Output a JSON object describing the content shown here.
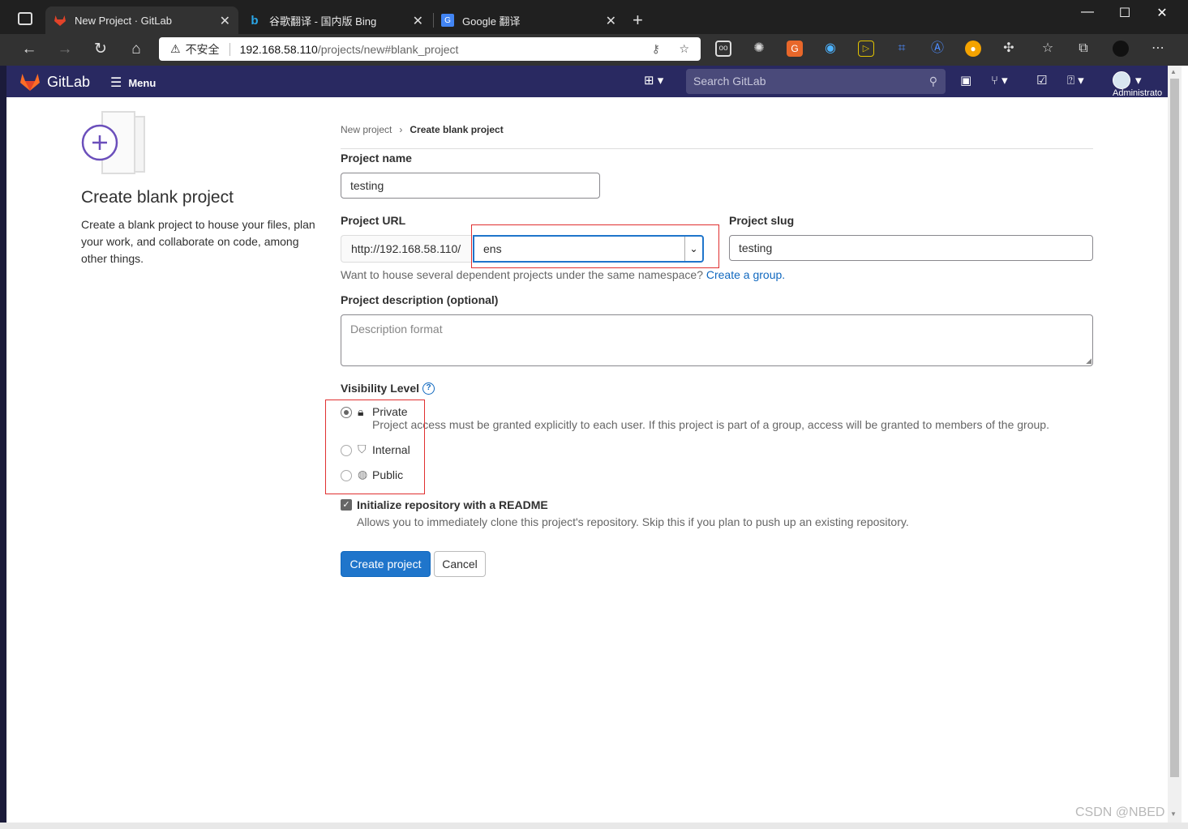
{
  "browser": {
    "tabs": [
      {
        "title": "New Project · GitLab",
        "active": true
      },
      {
        "title": "谷歌翻译 - 国内版 Bing",
        "active": false
      },
      {
        "title": "Google 翻译",
        "active": false
      }
    ],
    "security_label": "不安全",
    "url_host": "192.168.58.110",
    "url_path": "/projects/new#blank_project",
    "extensions": [
      "reader-icon",
      "settings-spider-icon",
      "translate-icon",
      "sync-icon",
      "terminal-icon",
      "crop-icon",
      "a-icon",
      "shield-icon",
      "puzzle-icon",
      "favorites-icon",
      "collections-icon",
      "profile-avatar",
      "more-icon"
    ]
  },
  "gitlab_header": {
    "brand": "GitLab",
    "menu_label": "Menu",
    "search_placeholder": "Search GitLab",
    "user_label": "Administrato"
  },
  "sidebar": {
    "title": "Create blank project",
    "description": "Create a blank project to house your files, plan your work, and collaborate on code, among other things."
  },
  "breadcrumb": {
    "parent": "New project",
    "separator": "›",
    "current": "Create blank project"
  },
  "form": {
    "project_name_label": "Project name",
    "project_name_value": "testing",
    "project_url_label": "Project URL",
    "url_prefix": "http://192.168.58.110/",
    "namespace_value": "ens",
    "project_slug_label": "Project slug",
    "project_slug_value": "testing",
    "namespace_help": "Want to house several dependent projects under the same namespace?",
    "create_group_link": "Create a group.",
    "description_label": "Project description (optional)",
    "description_placeholder": "Description format",
    "visibility_label": "Visibility Level",
    "visibility_options": [
      {
        "label": "Private",
        "icon": "lock-icon",
        "checked": true,
        "help": "Project access must be granted explicitly to each user. If this project is part of a group, access will be granted to members of the group."
      },
      {
        "label": "Internal",
        "icon": "shield-icon",
        "checked": false
      },
      {
        "label": "Public",
        "icon": "globe-icon",
        "checked": false
      }
    ],
    "readme_label": "Initialize repository with a README",
    "readme_checked": true,
    "readme_help": "Allows you to immediately clone this project's repository. Skip this if you plan to push up an existing repository.",
    "create_button": "Create project",
    "cancel_button": "Cancel"
  },
  "watermark": "CSDN @NBED",
  "colors": {
    "gitlab_nav": "#292961",
    "primary_button": "#1f75cb",
    "link": "#1068bf",
    "annotation_red": "#e03030"
  }
}
